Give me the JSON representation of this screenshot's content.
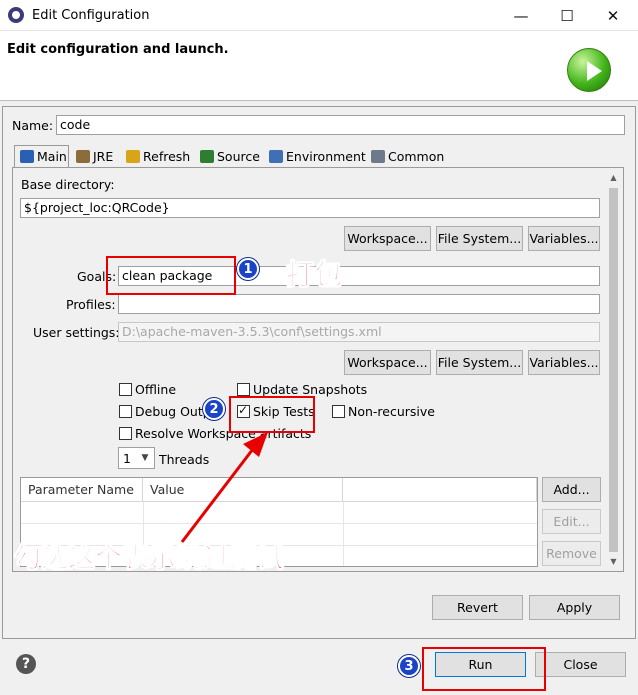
{
  "window": {
    "title": "Edit Configuration",
    "minimize": "—",
    "maximize": "☐",
    "close": "✕"
  },
  "header": {
    "text": "Edit configuration and launch."
  },
  "name": {
    "label": "Name:",
    "value": "code"
  },
  "tabs": [
    {
      "label": "Main",
      "color": "#2b5fb3"
    },
    {
      "label": "JRE",
      "color": "#8a6d3b"
    },
    {
      "label": "Refresh",
      "color": "#d8a41a"
    },
    {
      "label": "Source",
      "color": "#2e7d32"
    },
    {
      "label": "Environment",
      "color": "#3f6fb5"
    },
    {
      "label": "Common",
      "color": "#6c7a89"
    }
  ],
  "main": {
    "base_dir_label": "Base directory:",
    "base_dir_value": "${project_loc:QRCode}",
    "buttons1": {
      "workspace": "Workspace...",
      "filesystem": "File System...",
      "variables": "Variables..."
    },
    "goals_label": "Goals:",
    "goals_value": "clean package",
    "profiles_label": "Profiles:",
    "profiles_value": "",
    "user_settings_label": "User settings:",
    "user_settings_value": "D:\\apache-maven-3.5.3\\conf\\settings.xml",
    "buttons2": {
      "workspace": "Workspace...",
      "filesystem": "File System...",
      "variables": "Variables..."
    },
    "checkboxes": {
      "offline": {
        "label": "Offline",
        "checked": false
      },
      "update_snapshots": {
        "label": "Update Snapshots",
        "checked": false
      },
      "debug_output": {
        "label": "Debug Output",
        "checked": false
      },
      "skip_tests": {
        "label": "Skip Tests",
        "checked": true
      },
      "non_recursive": {
        "label": "Non-recursive",
        "checked": false
      },
      "resolve_workspace": {
        "label": "Resolve Workspace artifacts",
        "checked": false
      }
    },
    "threads": {
      "value": "1",
      "label": "Threads"
    },
    "table": {
      "col1": "Parameter Name",
      "col2": "Value"
    },
    "table_buttons": {
      "add": "Add...",
      "edit": "Edit...",
      "remove": "Remove"
    }
  },
  "actions": {
    "revert": "Revert",
    "apply": "Apply"
  },
  "footer": {
    "help": "?",
    "run": "Run",
    "close": "Close"
  },
  "annotations": {
    "badge1": "1",
    "badge2": "2",
    "badge3": "3",
    "text1": "打包",
    "text2": "勾选这个表示跳过测试",
    "color": "#e80000"
  }
}
